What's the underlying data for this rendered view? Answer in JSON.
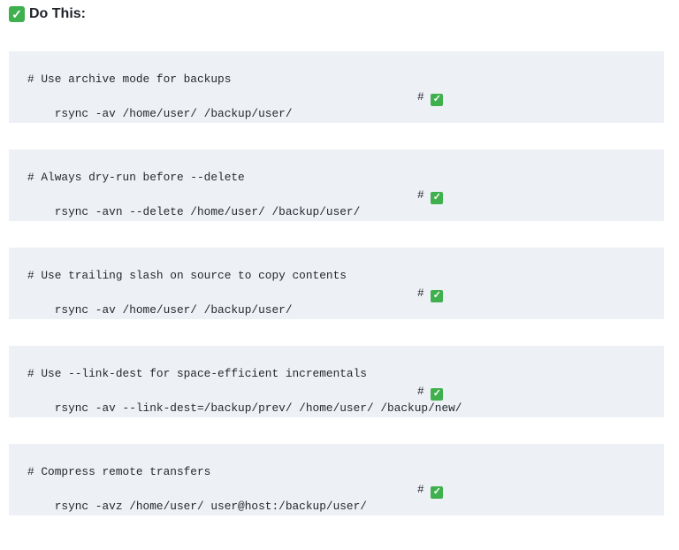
{
  "heading": {
    "icon": "check-mark-icon",
    "text": "Do This:"
  },
  "blocks": [
    {
      "comment": "# Use archive mode for backups",
      "command": "rsync -av /home/user/ /backup/user/",
      "marker": "#"
    },
    {
      "comment": "# Always dry-run before --delete",
      "command": "rsync -avn --delete /home/user/ /backup/user/",
      "marker": "#"
    },
    {
      "comment": "# Use trailing slash on source to copy contents",
      "command": "rsync -av /home/user/ /backup/user/",
      "marker": "#"
    },
    {
      "comment": "# Use --link-dest for space-efficient incrementals",
      "command": "rsync -av --link-dest=/backup/prev/ /home/user/ /backup/new/",
      "marker": "#"
    },
    {
      "comment": "# Compress remote transfers",
      "command": "rsync -avz /home/user/ user@host:/backup/user/",
      "marker": "#"
    }
  ],
  "colors": {
    "check_green": "#3fb04d",
    "code_background": "#edf1f6"
  }
}
